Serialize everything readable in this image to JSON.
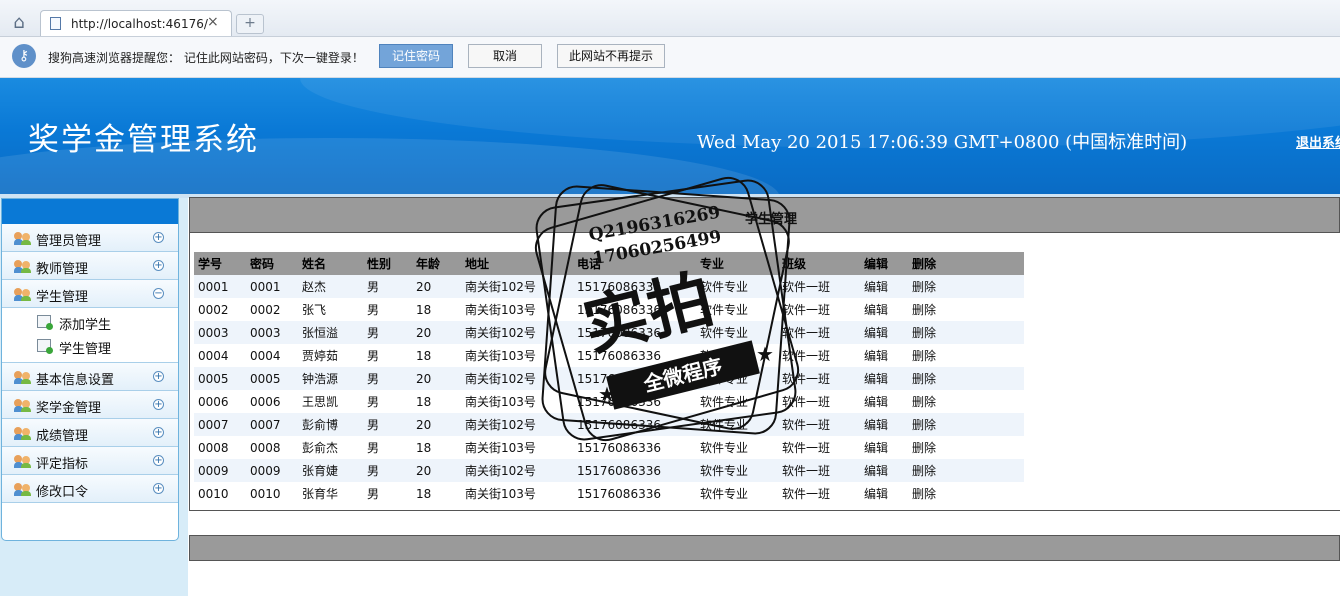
{
  "browser": {
    "tab_title": "http://localhost:46176/",
    "tab_close": "×",
    "new_tab": "+",
    "infobar": {
      "message": "搜狗高速浏览器提醒您： 记住此网站密码，下次一键登录！",
      "remember_btn": "记住密码",
      "cancel_btn": "取消",
      "never_btn": "此网站不再提示"
    }
  },
  "header": {
    "title": "奖学金管理系统",
    "clock": "Wed May 20 2015 17:06:39 GMT+0800 (中国标准时间)",
    "logout": "退出系统"
  },
  "sidebar": {
    "items": [
      {
        "label": "管理员管理",
        "toggle": "+"
      },
      {
        "label": "教师管理",
        "toggle": "+"
      },
      {
        "label": "学生管理",
        "toggle": "−"
      },
      {
        "label": "基本信息设置",
        "toggle": "+"
      },
      {
        "label": "奖学金管理",
        "toggle": "+"
      },
      {
        "label": "成绩管理",
        "toggle": "+"
      },
      {
        "label": "评定指标",
        "toggle": "+"
      },
      {
        "label": "修改口令",
        "toggle": "+"
      }
    ],
    "student_sub": [
      "添加学生",
      "学生管理"
    ]
  },
  "panel": {
    "title": "学生管理",
    "columns": [
      "学号",
      "密码",
      "姓名",
      "性别",
      "年龄",
      "地址",
      "电话",
      "专业",
      "班级",
      "编辑",
      "删除"
    ],
    "rows": [
      [
        "0001",
        "0001",
        "赵杰",
        "男",
        "20",
        "南关街102号",
        "15176086336",
        "软件专业",
        "软件一班",
        "编辑",
        "删除"
      ],
      [
        "0002",
        "0002",
        "张飞",
        "男",
        "18",
        "南关街103号",
        "15176086336",
        "软件专业",
        "软件一班",
        "编辑",
        "删除"
      ],
      [
        "0003",
        "0003",
        "张恒溢",
        "男",
        "20",
        "南关街102号",
        "15176086336",
        "软件专业",
        "软件一班",
        "编辑",
        "删除"
      ],
      [
        "0004",
        "0004",
        "贾婷茹",
        "男",
        "18",
        "南关街103号",
        "15176086336",
        "软件专业",
        "软件一班",
        "编辑",
        "删除"
      ],
      [
        "0005",
        "0005",
        "钟浩源",
        "男",
        "20",
        "南关街102号",
        "15176086336",
        "软件专业",
        "软件一班",
        "编辑",
        "删除"
      ],
      [
        "0006",
        "0006",
        "王思凯",
        "男",
        "18",
        "南关街103号",
        "15176086336",
        "软件专业",
        "软件一班",
        "编辑",
        "删除"
      ],
      [
        "0007",
        "0007",
        "彭俞博",
        "男",
        "20",
        "南关街102号",
        "15176086336",
        "软件专业",
        "软件一班",
        "编辑",
        "删除"
      ],
      [
        "0008",
        "0008",
        "彭俞杰",
        "男",
        "18",
        "南关街103号",
        "15176086336",
        "软件专业",
        "软件一班",
        "编辑",
        "删除"
      ],
      [
        "0009",
        "0009",
        "张育婕",
        "男",
        "20",
        "南关街102号",
        "15176086336",
        "软件专业",
        "软件一班",
        "编辑",
        "删除"
      ],
      [
        "0010",
        "0010",
        "张育华",
        "男",
        "18",
        "南关街103号",
        "15176086336",
        "软件专业",
        "软件一班",
        "编辑",
        "删除"
      ]
    ]
  },
  "watermark": {
    "qq": "Q2196316269",
    "phone": "17060256499",
    "big": "实拍",
    "ribbon": "全微程序"
  },
  "colors": {
    "header_blue": "#0a79d6",
    "table_header_gray": "#999999",
    "row_alt": "#eef4fb"
  }
}
